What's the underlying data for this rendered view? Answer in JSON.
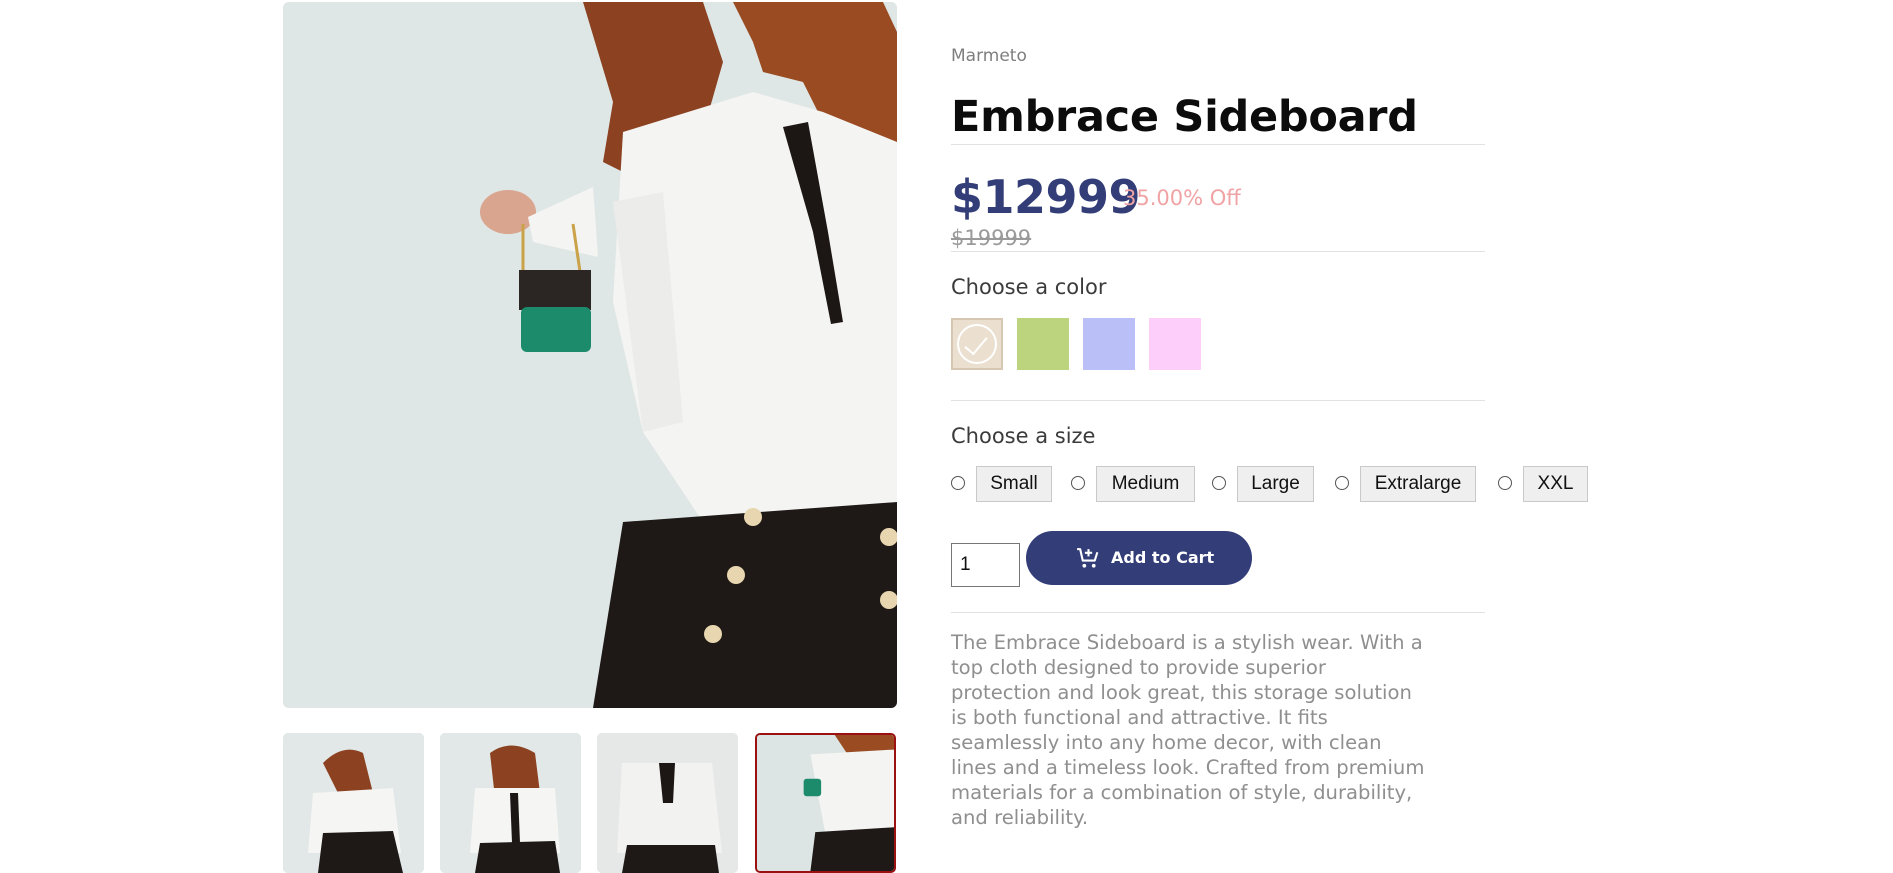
{
  "gallery": {
    "main_image_alt": "photo-woman-white-blouse-holding-green-perfume",
    "thumbnails": [
      {
        "name": "thumb-1",
        "active": false
      },
      {
        "name": "thumb-2",
        "active": false
      },
      {
        "name": "thumb-3",
        "active": false
      },
      {
        "name": "thumb-4",
        "active": true
      }
    ]
  },
  "product": {
    "brand": "Marmeto",
    "title": "Embrace Sideboard",
    "price": "$12999",
    "discount": "35.00% Off",
    "compare_price": "$19999",
    "color_label": "Choose a color",
    "colors": [
      {
        "name": "beige",
        "hex": "#ebdfcf",
        "selected": true
      },
      {
        "name": "green",
        "hex": "#bcd47e",
        "selected": false
      },
      {
        "name": "lavender",
        "hex": "#bbbff8",
        "selected": false
      },
      {
        "name": "pink",
        "hex": "#fecefa",
        "selected": false
      }
    ],
    "size_label": "Choose a size",
    "sizes": [
      "Small",
      "Medium",
      "Large",
      "Extralarge",
      "XXL"
    ],
    "quantity": "1",
    "add_to_cart_label": "Add to Cart",
    "description": "The Embrace Sideboard is a stylish wear. With a top cloth designed to provide superior protection and look great, this storage solution is both functional and attractive. It fits seamlessly into any home decor, with clean lines and a timeless look. Crafted from premium materials for a combination of style, durability, and reliability."
  },
  "theme": {
    "accent": "#333d78",
    "discount_color": "#f0a3a5",
    "active_thumb_border": "#9b1111"
  },
  "icons": {
    "cart": "add-to-cart-icon",
    "check": "check-icon"
  }
}
